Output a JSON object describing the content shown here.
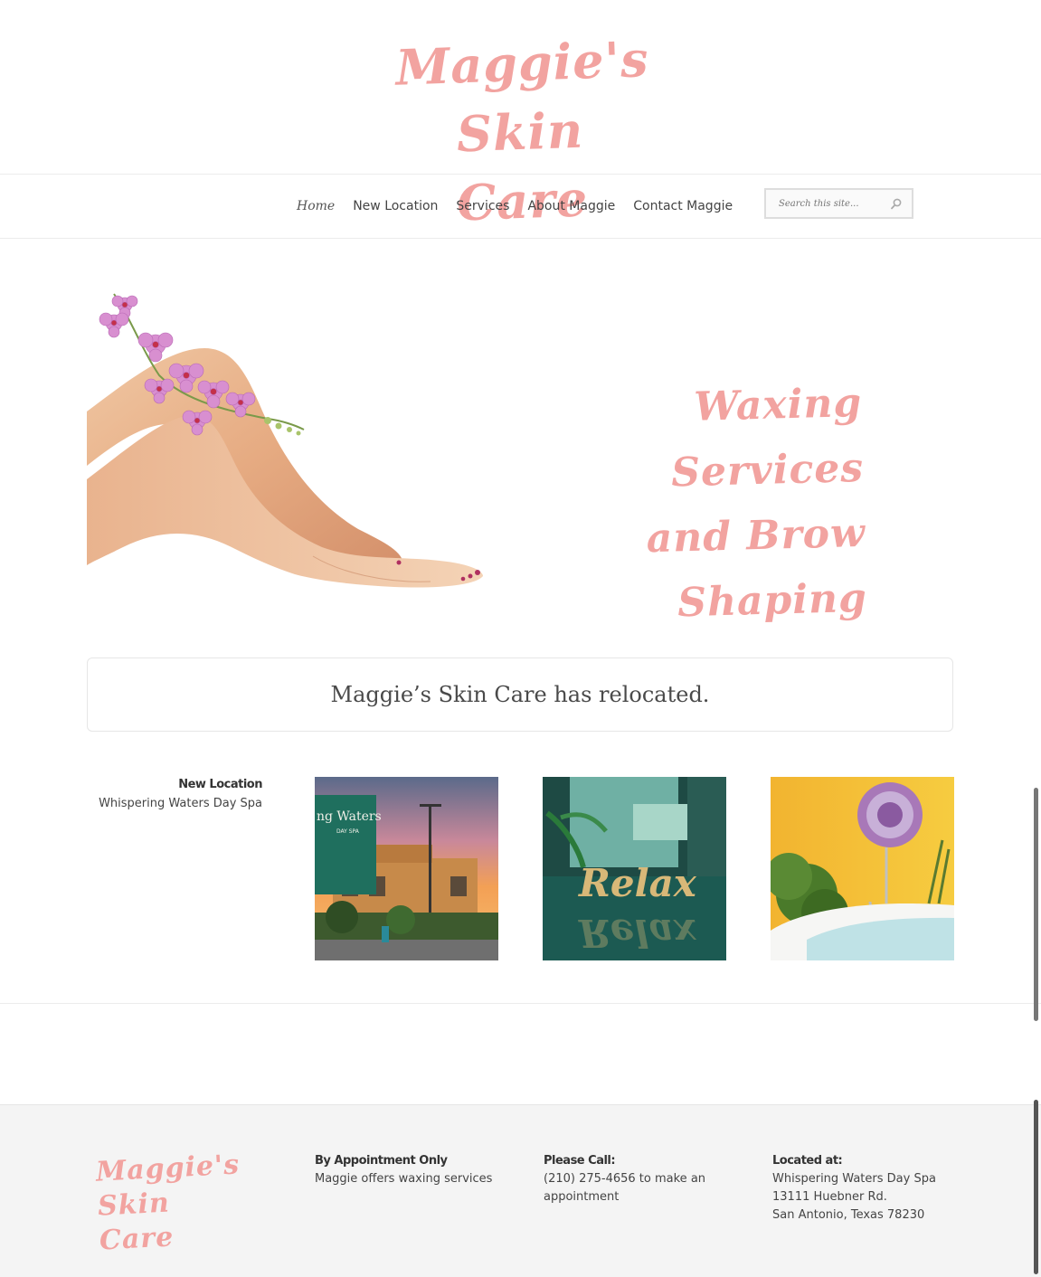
{
  "site": {
    "logo_line1": "Maggie's",
    "logo_line2": "Skin Care"
  },
  "nav": {
    "items": [
      {
        "label": "Home",
        "current": true
      },
      {
        "label": "New Location"
      },
      {
        "label": "Services"
      },
      {
        "label": "About Maggie"
      },
      {
        "label": "Contact Maggie"
      }
    ],
    "search_placeholder": "Search this site...",
    "search_icon": "search-icon"
  },
  "hero": {
    "line1": "Waxing Services",
    "line2": "and Brow Shaping"
  },
  "notice": "Maggie’s Skin Care has relocated.",
  "location": {
    "heading": "New Location",
    "name": "Whispering Waters Day Spa",
    "photo_sign_text": "ng Waters",
    "photo_sign_sub": "DAY SPA",
    "photo_relax_text": "Relax"
  },
  "footer": {
    "logo_line1": "Maggie's",
    "logo_line2": "Skin Care",
    "col1": {
      "heading": "By Appointment Only",
      "line1": "Maggie offers waxing services"
    },
    "col2": {
      "heading": "Please Call:",
      "line1": "(210) 275-4656 to make an",
      "line2": "appointment"
    },
    "col3": {
      "heading": "Located at:",
      "line1": "Whispering Waters Day Spa",
      "line2": "13111 Huebner Rd.",
      "line3": "San Antonio, Texas 78230"
    }
  },
  "colors": {
    "brand_pink": "#f2a3a0",
    "footer_bg": "#f4f4f4"
  }
}
